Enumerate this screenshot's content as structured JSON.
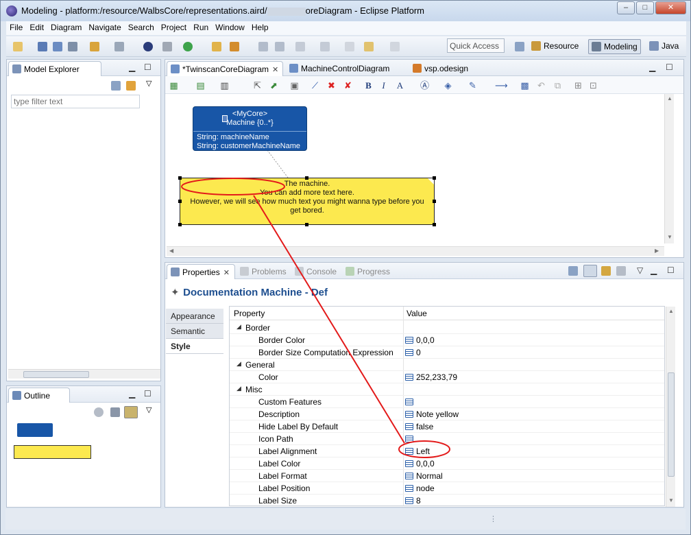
{
  "window": {
    "title_prefix": "Modeling - platform:/resource/WalbsCore/representations.aird/",
    "title_suffix": "oreDiagram - Eclipse Platform",
    "buttons": [
      "–",
      "□",
      "✕"
    ]
  },
  "menubar": [
    "File",
    "Edit",
    "Diagram",
    "Navigate",
    "Search",
    "Project",
    "Run",
    "Window",
    "Help"
  ],
  "toolbar": {
    "quick_access": "Quick Access",
    "perspectives": [
      "Resource",
      "Modeling",
      "Java"
    ]
  },
  "model_explorer": {
    "tab": "Model Explorer",
    "filter_placeholder": "type filter text"
  },
  "outline": {
    "tab": "Outline"
  },
  "editor": {
    "tabs": [
      "*TwinscanCoreDiagram",
      "MachineControlDiagram",
      "vsp.odesign"
    ],
    "class_node": {
      "stereotype": "<MyCore>",
      "name": "Machine {0..*}",
      "attributes": [
        "String: machineName",
        "String: customerMachineName"
      ]
    },
    "note": {
      "lines": [
        "The machine.",
        "You can add more text here.",
        "However, we will see how much text you might wanna type before you",
        "get bored."
      ]
    }
  },
  "bottom_tabs": [
    "Properties",
    "Problems",
    "Console",
    "Progress"
  ],
  "properties": {
    "title": "Documentation Machine - Def",
    "tabs": [
      "Appearance",
      "Semantic",
      "Style"
    ],
    "active_tab": "Style",
    "headers": {
      "property": "Property",
      "value": "Value"
    },
    "rows": [
      {
        "kind": "group",
        "name": "Border"
      },
      {
        "kind": "prop",
        "name": "Border Color",
        "value": "0,0,0"
      },
      {
        "kind": "prop",
        "name": "Border Size Computation Expression",
        "value": "0"
      },
      {
        "kind": "group",
        "name": "General"
      },
      {
        "kind": "prop",
        "name": "Color",
        "value": "252,233,79"
      },
      {
        "kind": "group",
        "name": "Misc"
      },
      {
        "kind": "prop",
        "name": "Custom Features",
        "value": ""
      },
      {
        "kind": "prop",
        "name": "Description",
        "value": "Note yellow"
      },
      {
        "kind": "prop",
        "name": "Hide Label By Default",
        "value": "false"
      },
      {
        "kind": "prop",
        "name": "Icon Path",
        "value": ""
      },
      {
        "kind": "prop",
        "name": "Label Alignment",
        "value": "Left"
      },
      {
        "kind": "prop",
        "name": "Label Color",
        "value": "0,0,0"
      },
      {
        "kind": "prop",
        "name": "Label Format",
        "value": "Normal"
      },
      {
        "kind": "prop",
        "name": "Label Position",
        "value": "node"
      },
      {
        "kind": "prop",
        "name": "Label Size",
        "value": "8"
      }
    ]
  },
  "colors": {
    "note_fill": "#fce94f",
    "class_fill": "#1856a7",
    "annotation": "#e31a1a",
    "title_blue": "#1d4e8f"
  }
}
